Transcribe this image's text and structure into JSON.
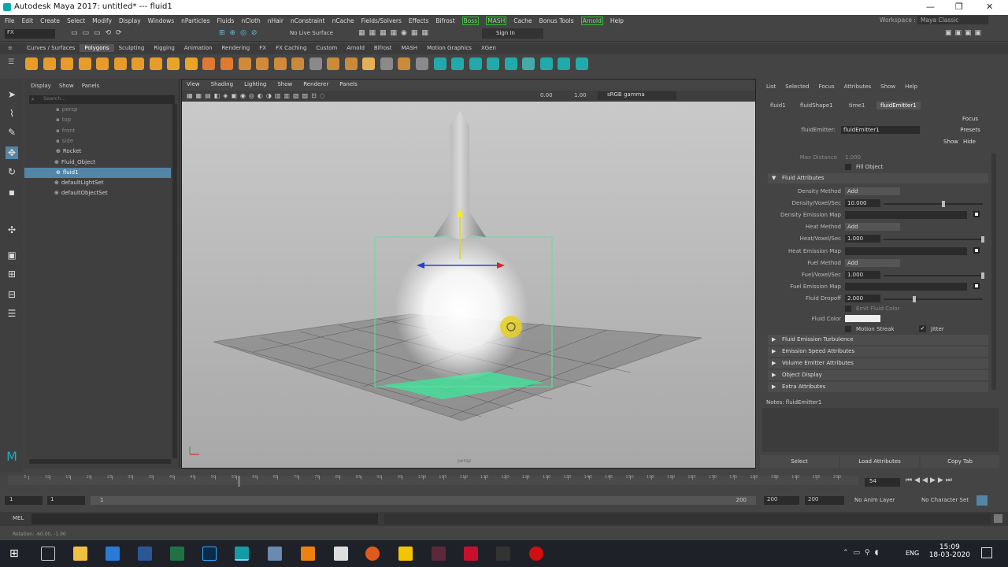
{
  "title": {
    "app": "Autodesk Maya 2017: untitled*  ---  fluid1"
  },
  "menubar": {
    "items": [
      "File",
      "Edit",
      "Create",
      "Select",
      "Modify",
      "Display",
      "Windows",
      "nParticles",
      "Fluids",
      "nCloth",
      "nHair",
      "nConstraint",
      "nCache",
      "Fields/Solvers",
      "Effects",
      "Bifrost",
      "Boss",
      "MASH",
      "Cache",
      "Bonus Tools",
      "Arnold",
      "Help"
    ],
    "workspace_label": "Workspace :",
    "workspace_value": "Maya Classic"
  },
  "statusline": {
    "mode": "FX",
    "live": "No Live Surface",
    "signin": "Sign In"
  },
  "shelf": {
    "tabs": [
      "Curves / Surfaces",
      "Polygons",
      "Sculpting",
      "Rigging",
      "Animation",
      "Rendering",
      "FX",
      "FX Caching",
      "Custom",
      "Arnold",
      "Bifrost",
      "MASH",
      "Motion Graphics",
      "XGen"
    ],
    "active": "Polygons"
  },
  "outliner": {
    "menu": [
      "Display",
      "Show",
      "Panels"
    ],
    "search_placeholder": "Search...",
    "items": [
      {
        "label": "persp",
        "dim": true
      },
      {
        "label": "top",
        "dim": true
      },
      {
        "label": "front",
        "dim": true
      },
      {
        "label": "side",
        "dim": true
      },
      {
        "label": "Rocket",
        "dim": false
      },
      {
        "label": "Fluid_Object",
        "dim": false
      },
      {
        "label": "fluid1",
        "dim": false,
        "selected": true
      },
      {
        "label": "defaultLightSet",
        "dim": false
      },
      {
        "label": "defaultObjectSet",
        "dim": false
      }
    ]
  },
  "viewport": {
    "menu": [
      "View",
      "Shading",
      "Lighting",
      "Show",
      "Renderer",
      "Panels"
    ],
    "exposure": "0.00",
    "gamma": "1.00",
    "colorspace": "sRGB gamma",
    "camera": "persp"
  },
  "ae": {
    "menu": [
      "List",
      "Selected",
      "Focus",
      "Attributes",
      "Show",
      "Help"
    ],
    "tabs": [
      "fluid1",
      "fluidShape1",
      "time1",
      "fluidEmitter1"
    ],
    "active_tab": "fluidEmitter1",
    "node_label": "fluidEmitter:",
    "node_value": "fluidEmitter1",
    "focus": "Focus",
    "presets": "Presets",
    "show": "Show",
    "hide": "Hide",
    "max_distance_label": "Max Distance",
    "max_distance_value": "1.000",
    "fill_object": "Fill Object",
    "section_fluid": "Fluid Attributes",
    "attrs": [
      {
        "label": "Density Method",
        "value": "Add",
        "kind": "dd"
      },
      {
        "label": "Density/Voxel/Sec",
        "value": "10.000",
        "kind": "field",
        "slider": 0.6
      },
      {
        "label": "Density Emission Map",
        "value": "",
        "kind": "map"
      },
      {
        "label": "Heat Method",
        "value": "Add",
        "kind": "dd"
      },
      {
        "label": "Heat/Voxel/Sec",
        "value": "1.000",
        "kind": "field",
        "slider": 1.0
      },
      {
        "label": "Heat Emission Map",
        "value": "",
        "kind": "map"
      },
      {
        "label": "Fuel Method",
        "value": "Add",
        "kind": "dd"
      },
      {
        "label": "Fuel/Voxel/Sec",
        "value": "1.000",
        "kind": "field",
        "slider": 1.0
      },
      {
        "label": "Fuel Emission Map",
        "value": "",
        "kind": "map"
      },
      {
        "label": "Fluid Dropoff",
        "value": "2.000",
        "kind": "field",
        "slider": 0.3
      }
    ],
    "emit_color": "Emit Fluid Color",
    "fluid_color": "Fluid Color",
    "motion_streak": "Motion Streak",
    "jitter": "Jitter",
    "sections": [
      "Fluid Emission Turbulence",
      "Emission Speed Attributes",
      "Volume Emitter Attributes",
      "Object Display",
      "Extra Attributes"
    ],
    "notes": "Notes: fluidEmitter1",
    "buttons": [
      "Select",
      "Load Attributes",
      "Copy Tab"
    ]
  },
  "timeline": {
    "ticks": [
      "5",
      "10",
      "15",
      "20",
      "25",
      "30",
      "35",
      "40",
      "45",
      "50",
      "55",
      "60",
      "65",
      "70",
      "75",
      "80",
      "85",
      "90",
      "95",
      "100",
      "105",
      "110",
      "115",
      "120",
      "125",
      "130",
      "135",
      "140",
      "145",
      "150",
      "155",
      "160",
      "165",
      "170",
      "175",
      "180",
      "185",
      "190",
      "195",
      "200"
    ],
    "current": "54",
    "current_fraction": 0.27
  },
  "range": {
    "start": "1",
    "start2": "1",
    "end": "200",
    "end2": "200",
    "end3": "200",
    "anim_layer": "No Anim Layer",
    "char_set": "No Character Set",
    "thumb_start": "1"
  },
  "cmdline": {
    "lang": "MEL"
  },
  "helpline": {
    "text": "Rotation: -60.00, -1.00"
  },
  "taskbar": {
    "lang": "ENG",
    "time": "15:09",
    "date": "18-03-2020"
  }
}
